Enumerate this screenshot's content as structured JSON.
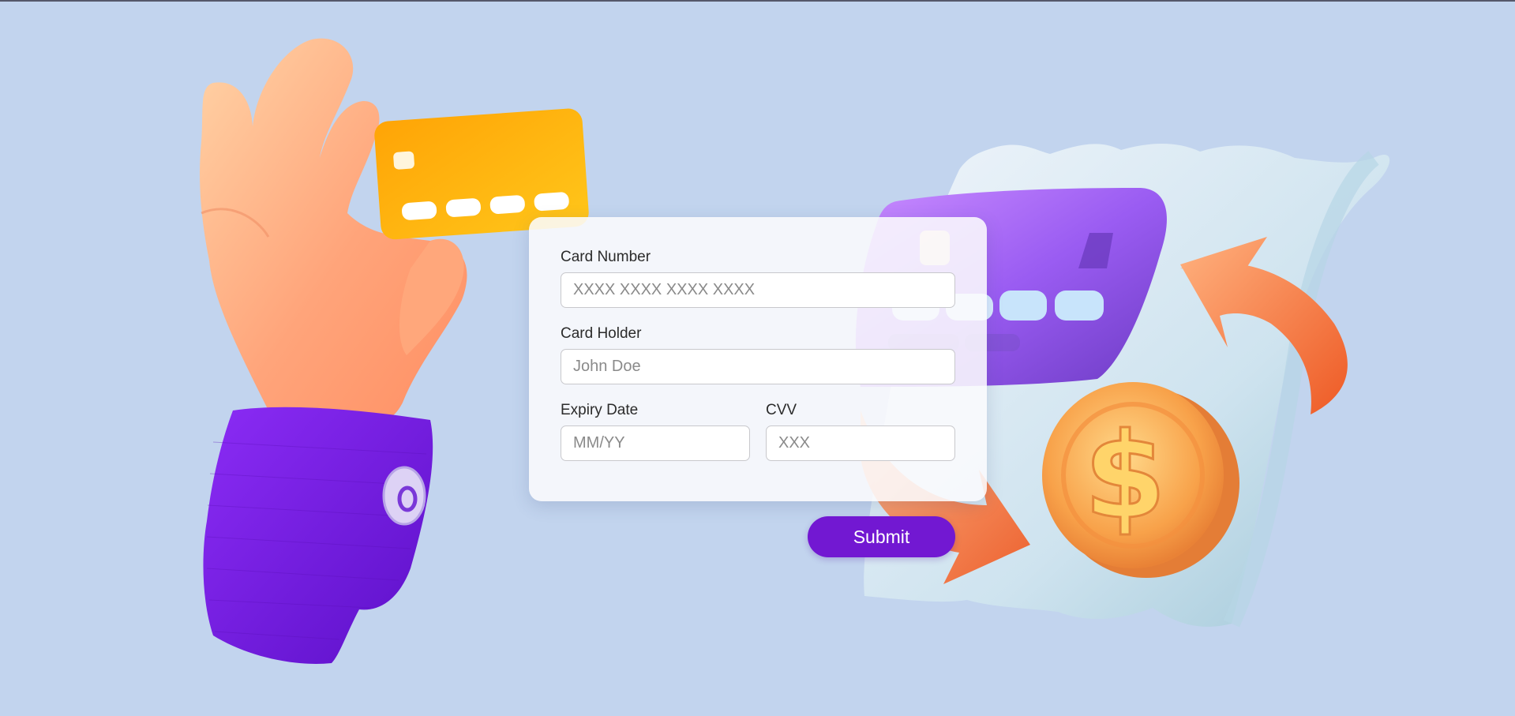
{
  "form": {
    "card_number": {
      "label": "Card Number",
      "placeholder": "XXXX XXXX XXXX XXXX",
      "value": ""
    },
    "card_holder": {
      "label": "Card Holder",
      "placeholder": "John Doe",
      "value": ""
    },
    "expiry": {
      "label": "Expiry Date",
      "placeholder": "MM/YY",
      "value": ""
    },
    "cvv": {
      "label": "CVV",
      "placeholder": "XXX",
      "value": ""
    },
    "submit_label": "Submit"
  },
  "colors": {
    "background": "#c2d4ee",
    "accent": "#7218d2",
    "sleeve": "#7a16e8",
    "card_yellow": "#ffb20a",
    "card_purple": "#9b5ef0",
    "coin": "#f9a84d",
    "arrow": "#f07a40"
  },
  "illustration": {
    "left": "hand-holding-credit-card",
    "right": "receipt-card-coin-arrow"
  }
}
